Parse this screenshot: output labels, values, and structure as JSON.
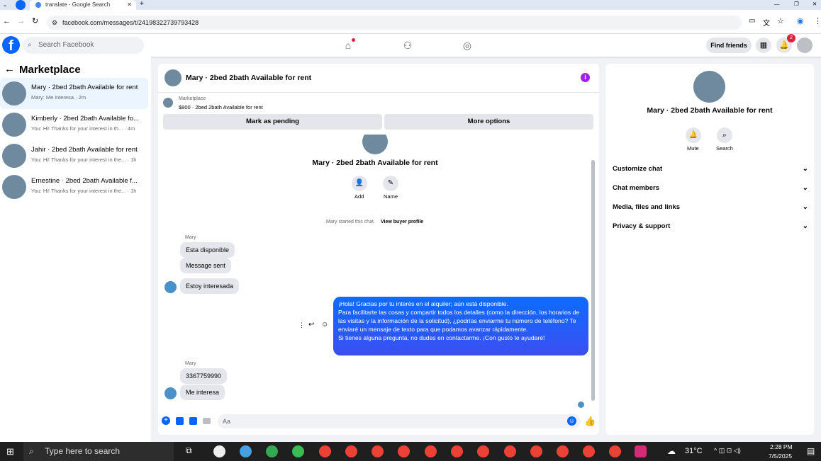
{
  "browser": {
    "tab_title": "translate - Google Search",
    "url": "facebook.com/messages/t/24198322739793428"
  },
  "header": {
    "search_placeholder": "Search Facebook",
    "find_friends": "Find friends",
    "notif_count": "2"
  },
  "left": {
    "title": "Marketplace",
    "conversations": [
      {
        "title": "Mary · 2bed 2bath Available for rent",
        "snippet": "Mary: Me interesa · 2m"
      },
      {
        "title": "Kimberly · 2bed 2bath Available fo...",
        "snippet": "You: Hi! Thanks for your interest in th... · 4m"
      },
      {
        "title": "Jahir · 2bed 2bath Available for rent",
        "snippet": "You: Hi! Thanks for your interest in the... · 1h"
      },
      {
        "title": "Ernestine · 2bed 2bath Available f...",
        "snippet": "You: Hi! Thanks for your interest in the... · 1h"
      }
    ]
  },
  "chat": {
    "title": "Mary · 2bed 2bath Available for rent",
    "marketplace_label": "Marketplace",
    "listing": "$800 · 2bed 2bath Available for rent",
    "mark_pending": "Mark as pending",
    "more_options": "More options",
    "center_title": "Mary · 2bed 2bath Available for rent",
    "add_label": "Add",
    "name_label": "Name",
    "started_text": "Mary started this chat.",
    "buyer_profile": "View buyer profile",
    "sender": "Mary",
    "msg1": "Esta disponible",
    "msg2": "Message sent",
    "msg3": "Estoy interesada",
    "out_lines": [
      "¡Hola! Gracias por tu interés en el alquiler; aún está disponible.",
      "Para facilitarte las cosas y compartir todos los detalles (como la dirección, los horarios de las visitas y la información de la solicitud), ¿podrías enviarme tu número de teléfono? Te enviaré un mensaje de texto para que podamos avanzar rápidamente.",
      "Si tienes alguna pregunta, no dudes en contactarme. ¡Con gusto te ayudaré!"
    ],
    "sender2": "Mary",
    "msg4": "3367759990",
    "msg5": "Me interesa",
    "composer_placeholder": "Aa"
  },
  "right": {
    "title": "Mary · 2bed 2bath Available for rent",
    "mute": "Mute",
    "search": "Search",
    "sections": [
      "Customize chat",
      "Chat members",
      "Media, files and links",
      "Privacy & support"
    ]
  },
  "taskbar": {
    "search_placeholder": "Type here to search",
    "weather": "31°C",
    "time": "2:28 PM",
    "date": "7/5/2025"
  },
  "colors": {
    "fb_blue": "#0866ff",
    "bubble": "#2f5bf5",
    "taskbar": "#1f1f1f"
  }
}
